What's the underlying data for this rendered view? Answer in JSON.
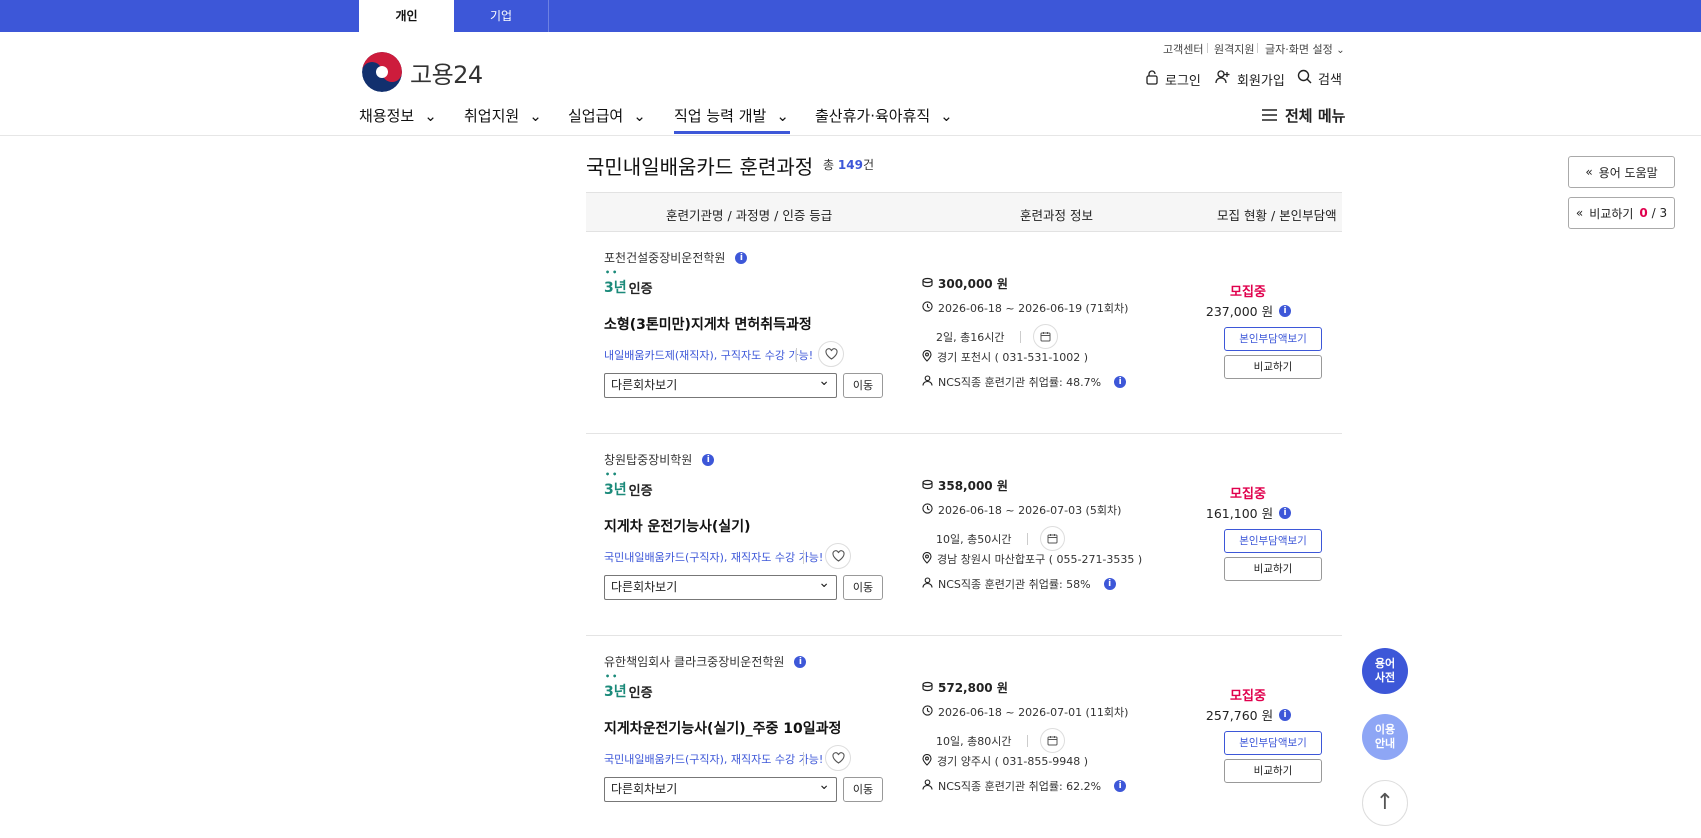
{
  "top_tabs": [
    "개인",
    "기업"
  ],
  "logo_text": "고용24",
  "util_links": [
    "고객센터",
    "원격지원",
    "글자·화면 설정"
  ],
  "auth": {
    "login": "로그인",
    "signup": "회원가입",
    "search": "검색"
  },
  "gnb": [
    "채용정보",
    "취업지원",
    "실업급여",
    "직업 능력 개발",
    "출산휴가·육아휴직"
  ],
  "all_menu": "전체 메뉴",
  "page_title": "국민내일배움카드 훈련과정",
  "count": {
    "prefix": "총",
    "value": "149",
    "suffix": "건"
  },
  "side": {
    "glossary": "용어 도움말",
    "compare_label": "비교하기",
    "compare_current": "0",
    "compare_total": "/ 3"
  },
  "table_header": [
    "훈련기관명 / 과정명 / 인증 등급",
    "훈련과정 정보",
    "모집 현황 / 본인부담액"
  ],
  "courses": [
    {
      "institution": "포천건설중장비운전학원",
      "cert_year": "3년",
      "cert_label": "인증",
      "name": "소형(3톤미만)지게차 면허취득과정",
      "tag": "내일배움카드제(재직자), 구직자도 수강 가능!",
      "select_value": "다른회차보기",
      "go": "이동",
      "fee": "300,000 원",
      "period": "2026-06-18 ~ 2026-06-19 (71회차)",
      "hours": "2일, 총16시간",
      "address": "경기 포천시 ( 031-531-1002 )",
      "ncs": "NCS직종 훈련기관 취업률: 48.7%",
      "status": "모집중",
      "price": "237,000 원",
      "burden_btn": "본인부담액보기",
      "compare_btn": "비교하기"
    },
    {
      "institution": "창원탑중장비학원",
      "cert_year": "3년",
      "cert_label": "인증",
      "name": "지게차 운전기능사(실기)",
      "tag": "국민내일배움카드(구직자), 재직자도 수강 가능!",
      "select_value": "다른회차보기",
      "go": "이동",
      "fee": "358,000 원",
      "period": "2026-06-18 ~ 2026-07-03 (5회차)",
      "hours": "10일, 총50시간",
      "address": "경남 창원시 마산합포구 ( 055-271-3535 )",
      "ncs": "NCS직종 훈련기관 취업률: 58%",
      "status": "모집중",
      "price": "161,100 원",
      "burden_btn": "본인부담액보기",
      "compare_btn": "비교하기"
    },
    {
      "institution": "유한책임회사 클라크중장비운전학원",
      "cert_year": "3년",
      "cert_label": "인증",
      "name": "지게차운전기능사(실기)_주중 10일과정",
      "tag": "국민내일배움카드(구직자), 재직자도 수강 가능!",
      "select_value": "다른회차보기",
      "go": "이동",
      "fee": "572,800 원",
      "period": "2026-06-18 ~ 2026-07-01 (11회차)",
      "hours": "10일, 총80시간",
      "address": "경기 양주시 ( 031-855-9948 )",
      "ncs": "NCS직종 훈련기관 취업률: 62.2%",
      "status": "모집중",
      "price": "257,760 원",
      "burden_btn": "본인부담액보기",
      "compare_btn": "비교하기"
    }
  ],
  "float": {
    "dict_line1": "용어",
    "dict_line2": "사전",
    "guide_line1": "이용",
    "guide_line2": "안내",
    "top": "↑"
  },
  "colors": {
    "brand": "#3d57d8",
    "recruiting": "#e0004d",
    "cert": "#1b8a7a"
  }
}
